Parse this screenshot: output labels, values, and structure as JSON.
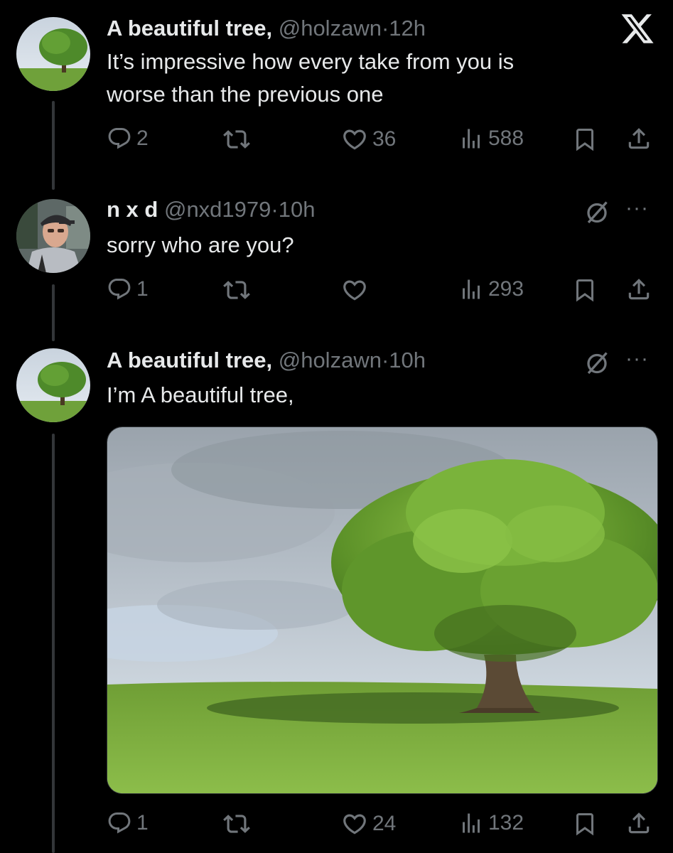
{
  "app": {
    "logo_icon": "x-logo-icon"
  },
  "tweets": [
    {
      "name": "A beautiful tree,",
      "handle": "@holzawn",
      "dot": "·",
      "time": "12h",
      "text_lines": [
        "It’s impressive how every take from you is",
        "worse than the previous one"
      ],
      "replies": "2",
      "likes": "36",
      "views": "588"
    },
    {
      "name": "n x d",
      "handle": "@nxd1979",
      "dot": "·",
      "time": "10h",
      "text_lines": [
        "sorry who are you?"
      ],
      "replies": "1",
      "views": "293",
      "more": "···"
    },
    {
      "name": "A beautiful tree,",
      "handle": "@holzawn",
      "dot": "·",
      "time": "10h",
      "text_lines": [
        "I’m A beautiful tree,"
      ],
      "replies": "1",
      "likes": "24",
      "views": "132",
      "more": "···"
    }
  ],
  "icons": {
    "reply": "reply-icon",
    "retweet": "retweet-icon",
    "like": "heart-icon",
    "views": "views-icon",
    "bookmark": "bookmark-icon",
    "share": "share-icon",
    "grok": "grok-icon"
  },
  "colors": {
    "background": "#000000",
    "text": "#e7e9ea",
    "muted": "#71767b",
    "thread_line": "#333639"
  }
}
